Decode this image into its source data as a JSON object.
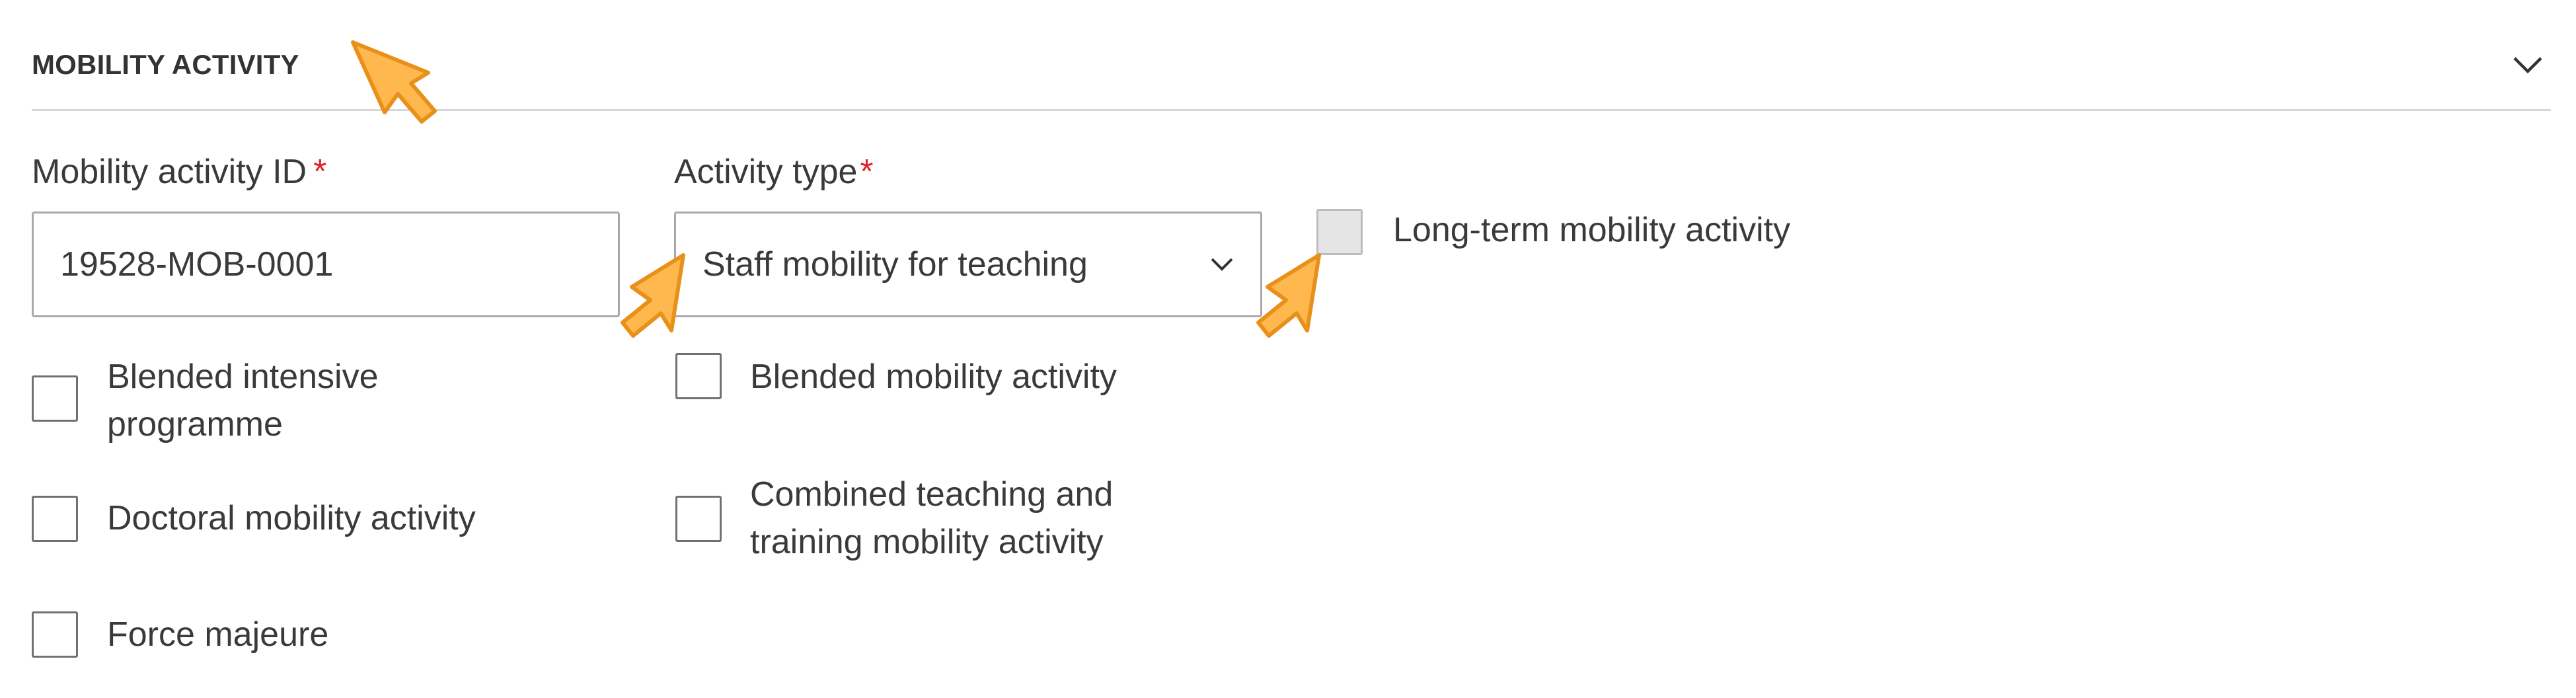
{
  "section": {
    "title": "MOBILITY ACTIVITY",
    "collapse_icon": "chevron-down-icon"
  },
  "fields": {
    "mobility_activity_id": {
      "label": "Mobility activity ID",
      "required_marker": "*",
      "value": "19528-MOB-0001"
    },
    "activity_type": {
      "label": "Activity type",
      "required_marker": "*",
      "selected": "Staff mobility for teaching",
      "dropdown_icon": "chevron-down-icon"
    }
  },
  "checkboxes": {
    "long_term": {
      "label": "Long-term mobility activity",
      "checked": false,
      "disabled": true
    },
    "blended_intensive": {
      "label_line1": "Blended intensive",
      "label_line2": "programme",
      "checked": false
    },
    "blended_mobility": {
      "label": "Blended mobility activity",
      "checked": false
    },
    "doctoral": {
      "label": "Doctoral mobility activity",
      "checked": false
    },
    "combined": {
      "label_line1": "Combined teaching and",
      "label_line2": "training mobility activity",
      "checked": false
    },
    "force_majeure": {
      "label": "Force majeure",
      "checked": false
    }
  },
  "colors": {
    "required": "#d9252a",
    "pointer_fill": "#ffb84d",
    "pointer_stroke": "#e8901a",
    "divider": "#d7d7d7"
  },
  "annotations": {
    "pointer_icon": "arrow-pointer-icon"
  }
}
